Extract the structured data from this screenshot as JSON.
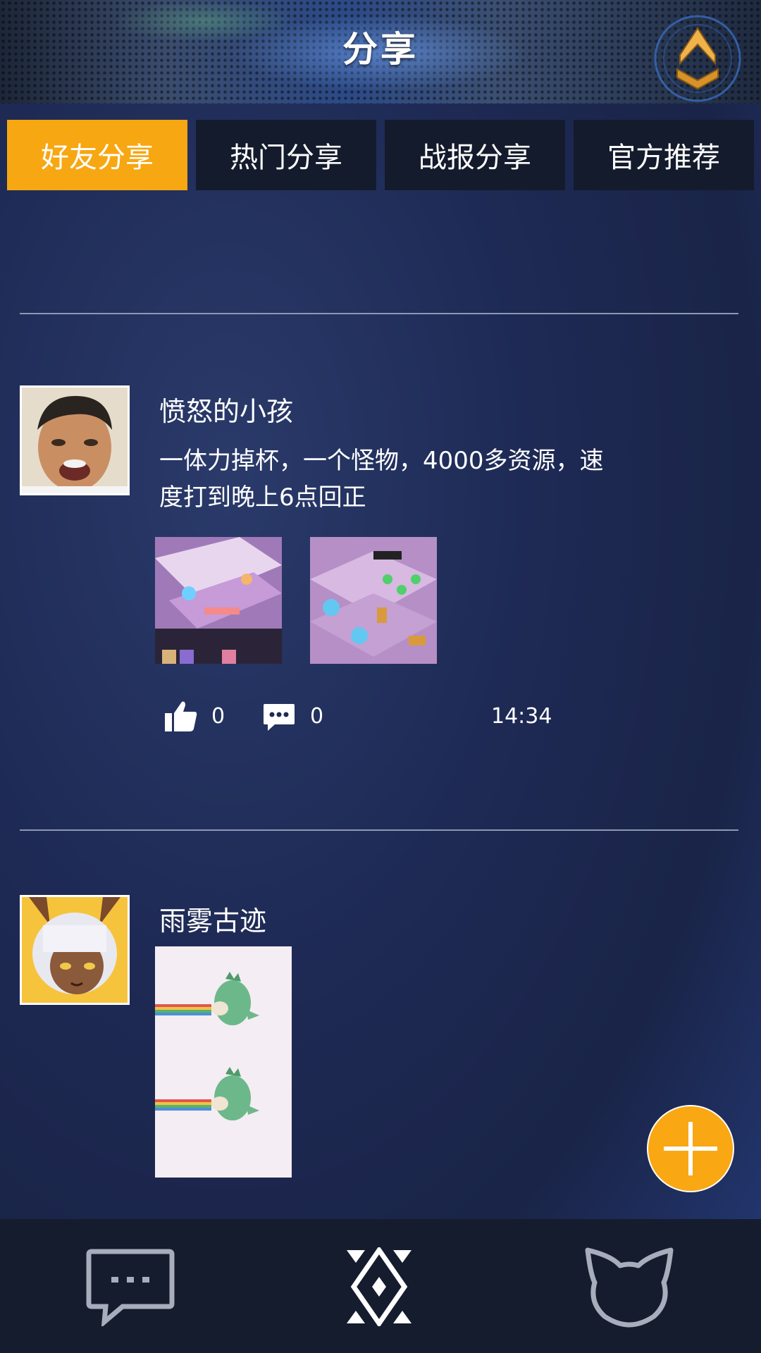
{
  "header": {
    "title": "分享"
  },
  "tabs": [
    {
      "label": "好友分享",
      "active": true
    },
    {
      "label": "热门分享",
      "active": false
    },
    {
      "label": "战报分享",
      "active": false
    },
    {
      "label": "官方推荐",
      "active": false
    }
  ],
  "posts": [
    {
      "username": "愤怒的小孩",
      "text_line1": "一体力掉杯，一个怪物，4000多资源，速",
      "text_line2": "度打到晚上6点回正",
      "likes": "0",
      "comments": "0",
      "time": "14:34"
    },
    {
      "username": "雨雾古迹"
    }
  ],
  "colors": {
    "accent": "#f7a712",
    "tab_bg": "#141b2c",
    "background": "#1e2a55",
    "bottom_bar": "#151c2e"
  },
  "icons": {
    "home": "home-arrow-icon",
    "like": "thumbs-up-icon",
    "comment": "comment-bubble-icon",
    "add": "plus-icon",
    "nav_chat": "chat-icon",
    "nav_center": "diamond-emblem-icon",
    "nav_pet": "cat-head-icon"
  }
}
